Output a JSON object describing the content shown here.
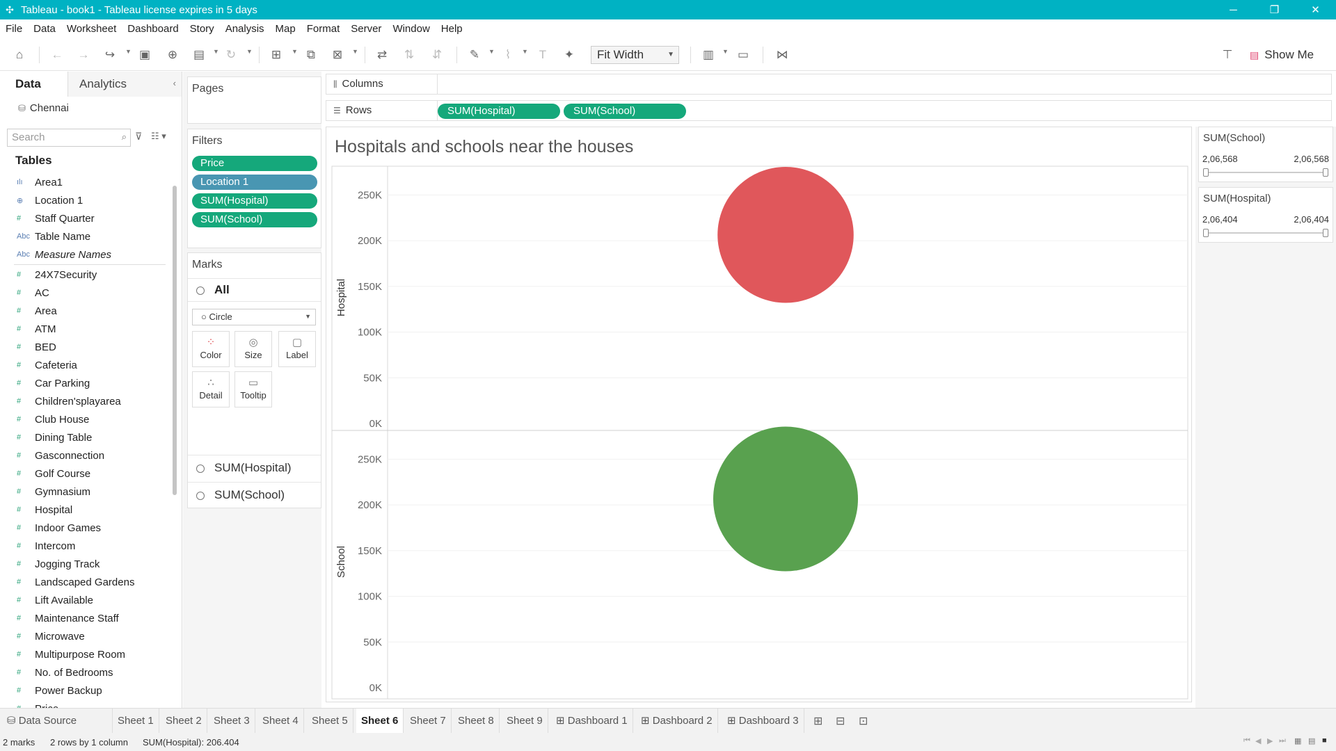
{
  "window": {
    "title": "Tableau - book1 - Tableau license expires in 5 days",
    "controls": [
      "─",
      "❐",
      "✕"
    ]
  },
  "menu": [
    "File",
    "Data",
    "Worksheet",
    "Dashboard",
    "Story",
    "Analysis",
    "Map",
    "Format",
    "Server",
    "Window",
    "Help"
  ],
  "toolbar": {
    "fit_label": "Fit Width",
    "show_me_label": "Show Me"
  },
  "data_pane": {
    "tab_data": "Data",
    "tab_analytics": "Analytics",
    "datasource": "Chennai",
    "search_placeholder": "Search",
    "tables_header": "Tables",
    "fields_top": [
      {
        "name": "Area1",
        "type": "bin"
      },
      {
        "name": "Location 1",
        "type": "geo"
      },
      {
        "name": "Staff Quarter",
        "type": "measure"
      },
      {
        "name": "Table Name",
        "type": "text"
      },
      {
        "name": "Measure Names",
        "type": "text"
      }
    ],
    "fields": [
      "24X7Security",
      "AC",
      "Area",
      "ATM",
      "BED",
      "Cafeteria",
      "Car Parking",
      "Children'splayarea",
      "Club House",
      "Dining Table",
      "Gasconnection",
      "Golf Course",
      "Gymnasium",
      "Hospital",
      "Indoor Games",
      "Intercom",
      "Jogging Track",
      "Landscaped Gardens",
      "Lift Available",
      "Maintenance Staff",
      "Microwave",
      "Multipurpose Room",
      "No. of Bedrooms",
      "Power Backup",
      "Price"
    ]
  },
  "pages": {
    "title": "Pages"
  },
  "filters": {
    "title": "Filters",
    "pills": [
      "Price",
      "Location 1",
      "SUM(Hospital)",
      "SUM(School)"
    ]
  },
  "marks": {
    "title": "Marks",
    "all_label": "All",
    "mark_type": "Circle",
    "buttons": [
      "Color",
      "Size",
      "Label",
      "Detail",
      "Tooltip"
    ],
    "measures": [
      "SUM(Hospital)",
      "SUM(School)"
    ]
  },
  "shelves": {
    "columns_label": "Columns",
    "rows_label": "Rows",
    "rows_pills": [
      "SUM(Hospital)",
      "SUM(School)"
    ]
  },
  "viz": {
    "title": "Hospitals and schools near the houses"
  },
  "chart_data": {
    "type": "scatter",
    "title": "Hospitals and schools near the houses",
    "panes": [
      {
        "ylabel": "Hospital",
        "value": 206404,
        "color": "#e0575b",
        "ylim": [
          0,
          280000
        ],
        "ticks": [
          "250K",
          "200K",
          "150K",
          "100K",
          "50K",
          "0K"
        ]
      },
      {
        "ylabel": "School",
        "value": 206568,
        "color": "#59a14f",
        "ylim": [
          0,
          280000
        ],
        "ticks": [
          "250K",
          "200K",
          "150K",
          "100K",
          "50K",
          "0K"
        ]
      }
    ],
    "grid": true
  },
  "legends": [
    {
      "title": "SUM(School)",
      "min": "2,06,568",
      "max": "2,06,568"
    },
    {
      "title": "SUM(Hospital)",
      "min": "2,06,404",
      "max": "2,06,404"
    }
  ],
  "sheet_tabs": {
    "data_source": "Data Source",
    "sheets": [
      "Sheet 1",
      "Sheet 2",
      "Sheet 3",
      "Sheet 4",
      "Sheet 5",
      "Sheet 6",
      "Sheet 7",
      "Sheet 8",
      "Sheet 9"
    ],
    "active": "Sheet 6",
    "dashboards": [
      "Dashboard 1",
      "Dashboard 2",
      "Dashboard 3"
    ]
  },
  "status": {
    "marks": "2 marks",
    "rows_cols": "2 rows by 1 column",
    "sum": "SUM(Hospital): 206.404"
  }
}
